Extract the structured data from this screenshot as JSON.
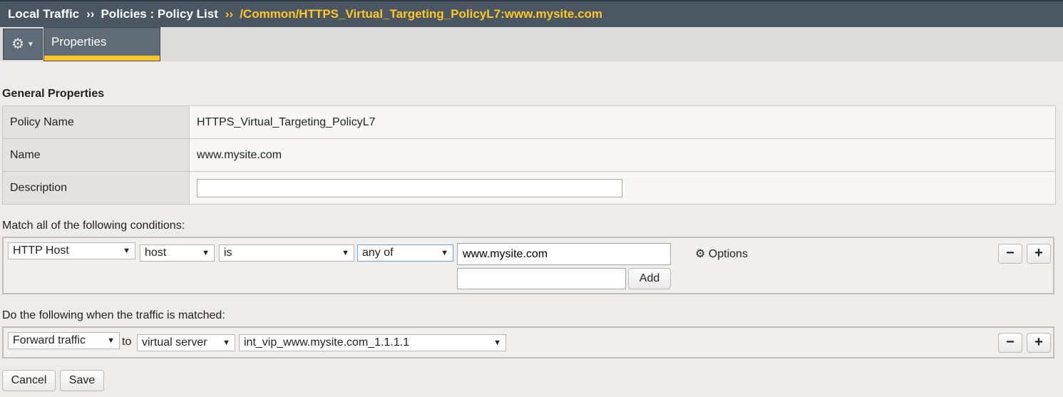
{
  "breadcrumb": {
    "item1": "Local Traffic",
    "item2": "Policies : Policy List",
    "separator": "››",
    "current": "/Common/HTTPS_Virtual_Targeting_PolicyL7:www.mysite.com"
  },
  "tabs": {
    "properties": "Properties"
  },
  "general": {
    "title": "General Properties",
    "rows": [
      {
        "label": "Policy Name",
        "value": "HTTPS_Virtual_Targeting_PolicyL7"
      },
      {
        "label": "Name",
        "value": "www.mysite.com"
      },
      {
        "label": "Description",
        "value": ""
      }
    ]
  },
  "conditions": {
    "heading": "Match all of the following conditions:",
    "selects": [
      "HTTP Host",
      "host",
      "is",
      "any of"
    ],
    "value": "www.mysite.com",
    "new_value": "",
    "add_label": "Add",
    "options_label": "Options",
    "minus_label": "−",
    "plus_label": "+"
  },
  "actions": {
    "heading": "Do the following when the traffic is matched:",
    "action_select": "Forward traffic",
    "to_label": "to",
    "target_type": "virtual server",
    "target": "int_vip_www.mysite.com_1.1.1.1",
    "minus_label": "−",
    "plus_label": "+"
  },
  "footer": {
    "cancel_label": "Cancel",
    "save_label": "Save"
  },
  "colors": {
    "header_bg": "#4a5763",
    "breadcrumb_current": "#ffc726",
    "tab_accent": "#ffc726"
  },
  "icons": {
    "gear": "gear-icon",
    "dropdown": "chevron-down-icon"
  }
}
